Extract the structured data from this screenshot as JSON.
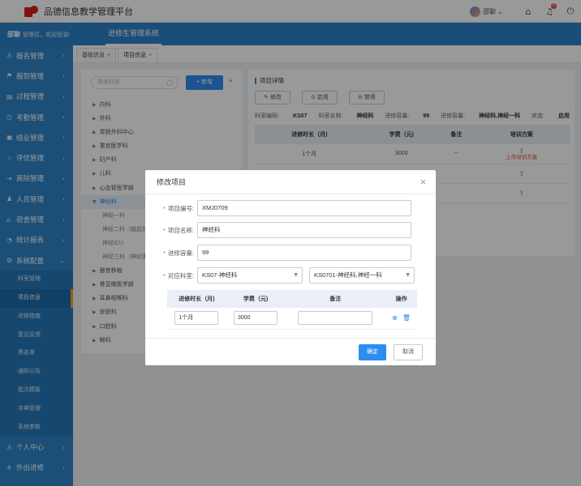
{
  "app": {
    "title": "品德信息教学管理平台"
  },
  "topbar": {
    "username": "邵聊",
    "dropdown_icon": "chevron-down-icon",
    "badge_count": "0"
  },
  "navbar": {
    "user_name": "邵聊",
    "welcome": "管理员，欢迎登录!",
    "system_tab": "进修生管理系统"
  },
  "sidebar": {
    "items": [
      {
        "label": "报名管理",
        "icon": "user-plus-icon"
      },
      {
        "label": "报到管理",
        "icon": "flag-icon"
      },
      {
        "label": "过程管理",
        "icon": "process-icon"
      },
      {
        "label": "考勤管理",
        "icon": "clock-icon"
      },
      {
        "label": "结业管理",
        "icon": "certificate-icon"
      },
      {
        "label": "评优管理",
        "icon": "star-icon"
      },
      {
        "label": "离院管理",
        "icon": "exit-icon"
      },
      {
        "label": "人员管理",
        "icon": "people-icon"
      },
      {
        "label": "宿舍管理",
        "icon": "home-icon"
      },
      {
        "label": "统计报表",
        "icon": "chart-icon"
      },
      {
        "label": "系统配置",
        "icon": "gear-icon"
      }
    ],
    "submenu": [
      "科室管理",
      "项目信息",
      "进修指南",
      "意见反馈",
      "黑名单",
      "通知公告",
      "批次模板",
      "字典管理",
      "系统参数"
    ],
    "bottom_items": [
      {
        "label": "个人中心",
        "icon": "user-icon"
      },
      {
        "label": "外出进修",
        "icon": "plane-icon"
      }
    ]
  },
  "tabs": [
    {
      "label": "基础信息"
    },
    {
      "label": "项目信息"
    }
  ],
  "tree": {
    "search_placeholder": "搜索科室",
    "add_label": "+ 新增",
    "nodes": [
      "内科",
      "外科",
      "胃肠外科中心",
      "重症医学科",
      "妇产科",
      "儿科",
      "心血管医学部",
      "神经科"
    ],
    "children": [
      "神经一科",
      "神经二科（脑血管",
      "神经ICU",
      "神经三科（神经重"
    ],
    "nodes_after": [
      "器官移植",
      "骨显微医学部",
      "耳鼻咽喉科",
      "皮肤科",
      "口腔科",
      "眼科"
    ]
  },
  "detail": {
    "title": "项目详情",
    "buttons": {
      "edit": "修改",
      "enable": "启用",
      "disable": "禁用"
    },
    "info": {
      "dept_code_label": "科室编码:",
      "dept_code": "KS07",
      "dept_name_label": "科室名称:",
      "dept_name": "神经科",
      "capacity_label": "进修容量:",
      "capacity": "99",
      "target_label": "进修容量:",
      "target": "神经科,神经一科",
      "status_label": "状态:",
      "status": "启用"
    },
    "table_headers": [
      "进修时长（月)",
      "学费（元)",
      "备注",
      "培训方案"
    ],
    "rows": [
      {
        "duration": "1个月",
        "fee": "3000",
        "note": "--",
        "upload_text": "上传培训方案"
      },
      {
        "duration": "",
        "fee": "",
        "note": "",
        "upload_text": ""
      },
      {
        "duration": "",
        "fee": "",
        "note": "",
        "upload_text": ""
      }
    ]
  },
  "modal": {
    "title": "修改项目",
    "fields": {
      "code_label": "项目编号:",
      "code_value": "XMJ0709",
      "name_label": "项目名称:",
      "name_value": "神经科",
      "capacity_label": "进修容量:",
      "capacity_value": "99",
      "dept_label": "对应科室:",
      "dept_select": "KS07-神经科",
      "sub_select": "KS0701-神经科,神经一科"
    },
    "table_headers": [
      "进修时长（月)",
      "学费（元)",
      "备注",
      "操作"
    ],
    "row": {
      "duration": "1个月",
      "fee": "3000",
      "note": ""
    },
    "ok_label": "确定",
    "cancel_label": "取消"
  }
}
